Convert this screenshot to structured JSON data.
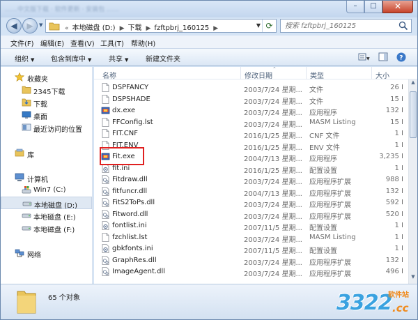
{
  "window": {
    "title_blurred": "……中文版下载 · 软件更新 · 安装包 ……",
    "close_glyph": "✕"
  },
  "address": {
    "crumbs": [
      "本地磁盘 (D:)",
      "下载",
      "fzftpbrj_160125"
    ],
    "search_placeholder": "搜索 fzftpbrj_160125"
  },
  "menu": [
    "文件(F)",
    "编辑(E)",
    "查看(V)",
    "工具(T)",
    "帮助(H)"
  ],
  "toolbar": {
    "organize": "组织",
    "include_library": "包含到库中",
    "share": "共享",
    "new_folder": "新建文件夹"
  },
  "sidebar": {
    "favorites": "收藏夹",
    "fav_items": [
      "2345下载",
      "下载",
      "桌面",
      "最近访问的位置"
    ],
    "libraries": "库",
    "computer": "计算机",
    "drives": [
      "Win7 (C:)",
      "本地磁盘 (D:)",
      "本地磁盘 (E:)",
      "本地磁盘 (F:)"
    ],
    "network": "网络"
  },
  "columns": {
    "name": "名称",
    "modified": "修改日期",
    "type": "类型",
    "size": "大小"
  },
  "files": [
    {
      "name": "DSPFANCY",
      "date": "2003/7/24 星期...",
      "type": "文件",
      "size": "26 I",
      "icon": "file"
    },
    {
      "name": "DSPSHADE",
      "date": "2003/7/24 星期...",
      "type": "文件",
      "size": "15 I",
      "icon": "file"
    },
    {
      "name": "dx.exe",
      "date": "2003/7/24 星期...",
      "type": "应用程序",
      "size": "132 I",
      "icon": "exe"
    },
    {
      "name": "FFConfig.lst",
      "date": "2003/7/24 星期...",
      "type": "MASM Listing",
      "size": "15 I",
      "icon": "file"
    },
    {
      "name": "FIT.CNF",
      "date": "2016/1/25 星期...",
      "type": "CNF 文件",
      "size": "1 I",
      "icon": "file"
    },
    {
      "name": "FIT.ENV",
      "date": "2016/1/25 星期...",
      "type": "ENV 文件",
      "size": "1 I",
      "icon": "file"
    },
    {
      "name": "Fit.exe",
      "date": "2004/7/13 星期...",
      "type": "应用程序",
      "size": "3,235 I",
      "icon": "exe"
    },
    {
      "name": "fit.ini",
      "date": "2016/1/25 星期...",
      "type": "配置设置",
      "size": "1 I",
      "icon": "ini"
    },
    {
      "name": "Fitdraw.dll",
      "date": "2003/7/24 星期...",
      "type": "应用程序扩展",
      "size": "988 I",
      "icon": "dll"
    },
    {
      "name": "fitfuncr.dll",
      "date": "2004/7/13 星期...",
      "type": "应用程序扩展",
      "size": "132 I",
      "icon": "dll"
    },
    {
      "name": "FitS2ToPs.dll",
      "date": "2003/7/24 星期...",
      "type": "应用程序扩展",
      "size": "592 I",
      "icon": "dll"
    },
    {
      "name": "Fitword.dll",
      "date": "2003/7/24 星期...",
      "type": "应用程序扩展",
      "size": "520 I",
      "icon": "dll"
    },
    {
      "name": "fontlist.ini",
      "date": "2007/11/5 星期...",
      "type": "配置设置",
      "size": "1 I",
      "icon": "ini"
    },
    {
      "name": "fzchlist.lst",
      "date": "2003/7/24 星期...",
      "type": "MASM Listing",
      "size": "1 I",
      "icon": "file"
    },
    {
      "name": "gbkfonts.ini",
      "date": "2007/11/5 星期...",
      "type": "配置设置",
      "size": "1 I",
      "icon": "ini"
    },
    {
      "name": "GraphRes.dll",
      "date": "2003/7/24 星期...",
      "type": "应用程序扩展",
      "size": "132 I",
      "icon": "dll"
    },
    {
      "name": "ImageAgent.dll",
      "date": "2003/7/24 星期...",
      "type": "应用程序扩展",
      "size": "496 I",
      "icon": "dll"
    }
  ],
  "status": {
    "count": "65 个对象"
  },
  "watermark": {
    "number": "3322",
    "suffix": ".cc",
    "label": "软件站"
  }
}
